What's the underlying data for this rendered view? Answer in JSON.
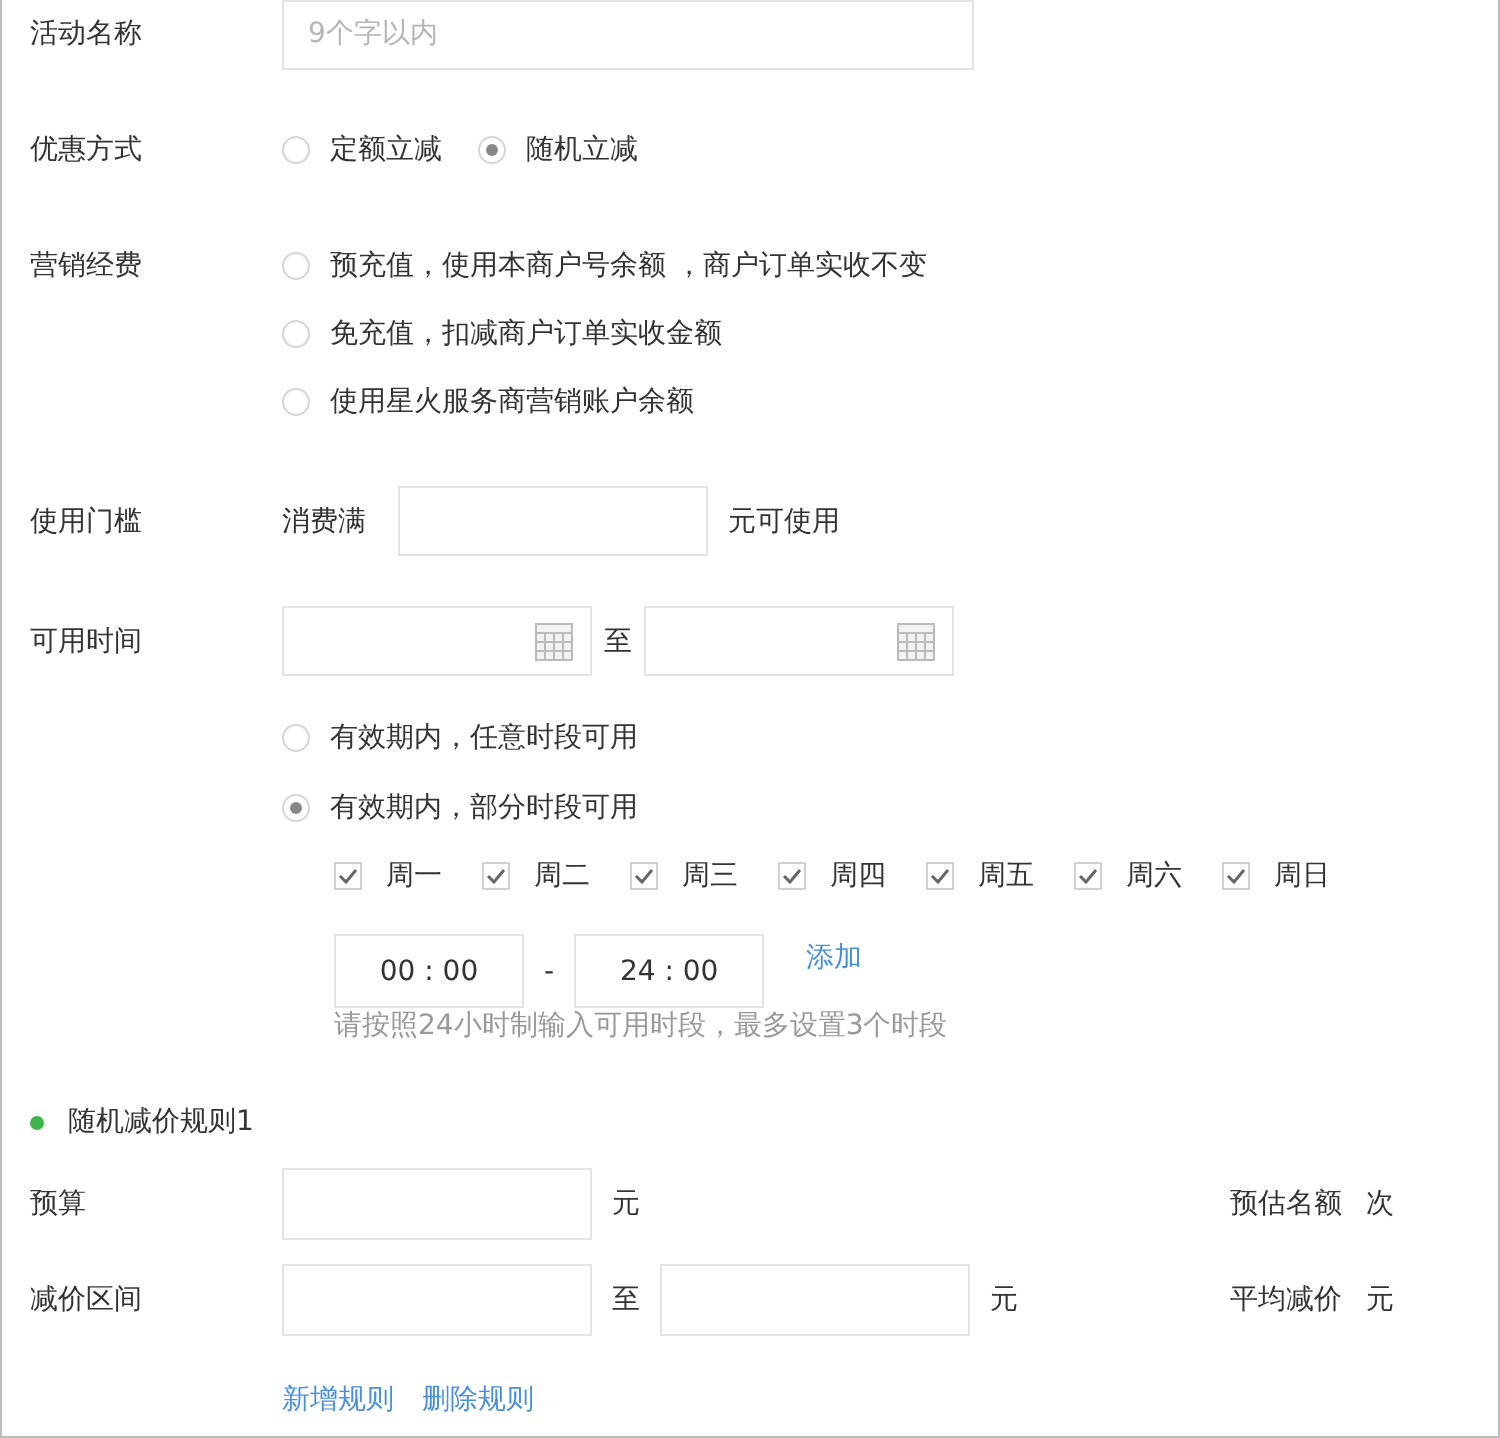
{
  "activity_name": {
    "label": "活动名称",
    "placeholder": "9个字以内"
  },
  "discount_type": {
    "label": "优惠方式",
    "options": [
      {
        "label": "定额立减",
        "selected": false
      },
      {
        "label": "随机立减",
        "selected": true
      }
    ]
  },
  "marketing_fee": {
    "label": "营销经费",
    "options": [
      {
        "label": "预充值，使用本商户号余额 ，商户订单实收不变",
        "selected": false
      },
      {
        "label": "免充值，扣减商户订单实收金额",
        "selected": false
      },
      {
        "label": "使用星火服务商营销账户余额",
        "selected": false
      }
    ]
  },
  "threshold": {
    "label": "使用门槛",
    "prefix": "消费满",
    "suffix": "元可使用"
  },
  "available_time": {
    "label": "可用时间",
    "separator": "至",
    "modes": [
      {
        "label": "有效期内，任意时段可用",
        "selected": false
      },
      {
        "label": "有效期内，部分时段可用",
        "selected": true
      }
    ],
    "weekdays": [
      {
        "label": "周一",
        "checked": true
      },
      {
        "label": "周二",
        "checked": true
      },
      {
        "label": "周三",
        "checked": true
      },
      {
        "label": "周四",
        "checked": true
      },
      {
        "label": "周五",
        "checked": true
      },
      {
        "label": "周六",
        "checked": true
      },
      {
        "label": "周日",
        "checked": true
      }
    ],
    "time_start": "00 : 00",
    "dash": "-",
    "time_end": "24 : 00",
    "add_link": "添加",
    "hint": "请按照24小时制输入可用时段，最多设置3个时段"
  },
  "rule": {
    "title": "随机减价规则1",
    "budget": {
      "label": "预算",
      "unit": "元",
      "estimate_label": "预估名额",
      "estimate_unit": "次"
    },
    "range": {
      "label": "减价区间",
      "separator": "至",
      "unit": "元",
      "average_label": "平均减价",
      "average_unit": "元"
    },
    "links": [
      "新增规则",
      "删除规则"
    ]
  }
}
